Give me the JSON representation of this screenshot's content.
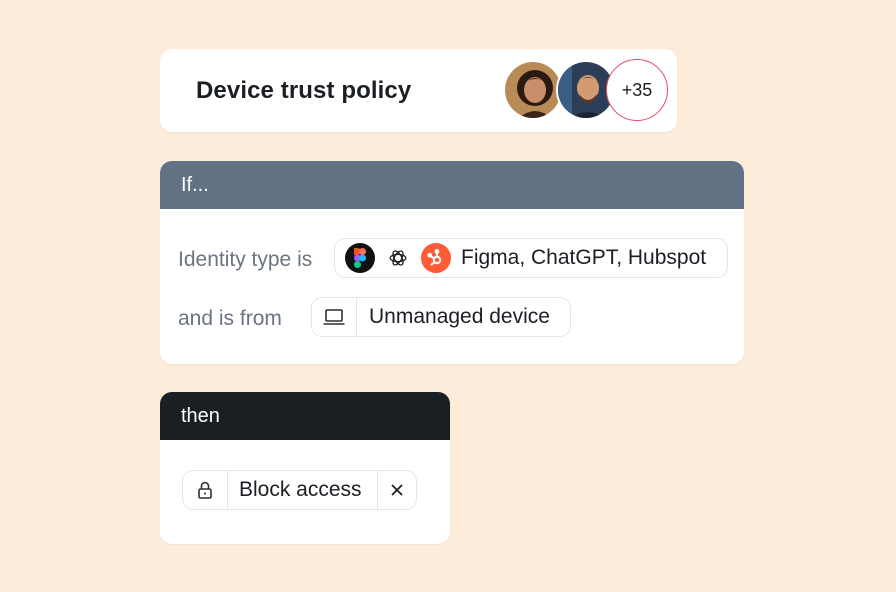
{
  "policy": {
    "title": "Device trust policy",
    "avatars": [
      "avatar-woman",
      "avatar-man"
    ],
    "more_count": "+35"
  },
  "if_section": {
    "header": "If...",
    "condition_1": {
      "label": "Identity type is",
      "icons": [
        "figma-icon",
        "chatgpt-icon",
        "hubspot-icon"
      ],
      "value": "Figma, ChatGPT, Hubspot"
    },
    "condition_2": {
      "label": "and is from",
      "icon": "laptop-icon",
      "value": "Unmanaged device"
    }
  },
  "then_section": {
    "header": "then",
    "action": {
      "icon": "lock-icon",
      "value": "Block access",
      "remove_icon": "close-icon"
    }
  },
  "colors": {
    "background": "#fcecd9",
    "if_header": "#637185",
    "then_header": "#1a1f23",
    "count_ring": "#e64b6a",
    "hubspot": "#ff5c35"
  }
}
